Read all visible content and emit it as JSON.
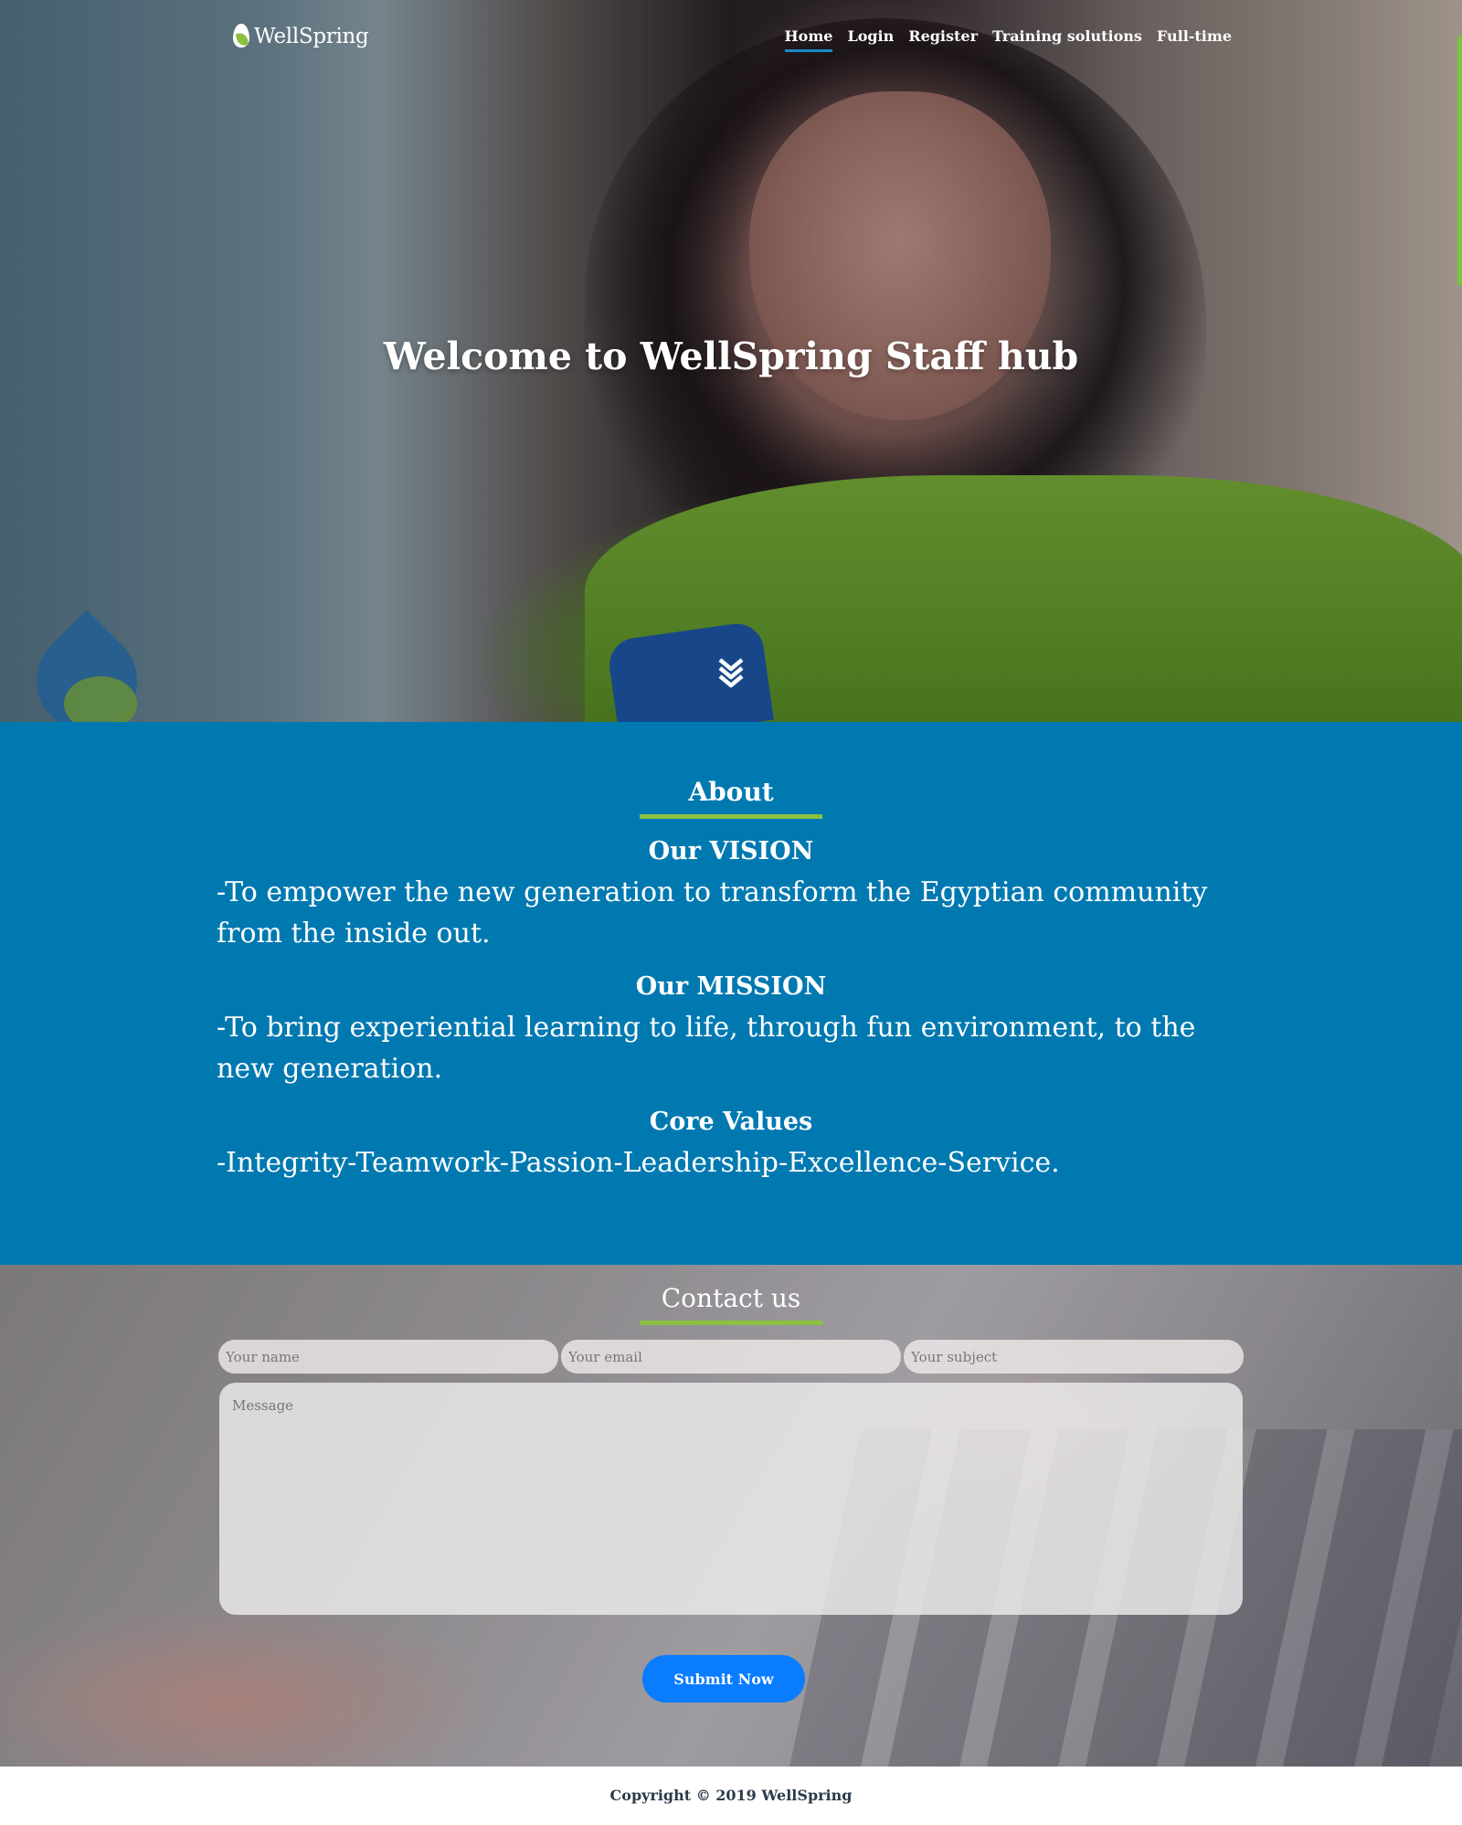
{
  "brand": {
    "name": "WellSpring",
    "logo_icon": "wellspring-drop-leaf-logo"
  },
  "nav": {
    "items": [
      {
        "label": "Home",
        "active": true
      },
      {
        "label": "Login",
        "active": false
      },
      {
        "label": "Register",
        "active": false
      },
      {
        "label": "Training solutions",
        "active": false
      },
      {
        "label": "Full-time",
        "active": false
      }
    ]
  },
  "hero": {
    "title": "Welcome to WellSpring Staff hub",
    "scroll_icon": "double-chevron-down-icon"
  },
  "about": {
    "heading": "About",
    "vision_title": "Our VISION",
    "vision_text": "-To empower the new generation to transform the Egyptian community from the inside out.",
    "mission_title": "Our MISSION",
    "mission_text": "-To bring experiential learning to life, through fun environment, to the new generation.",
    "values_title": "Core Values",
    "values_text": "-Integrity-Teamwork-Passion-Leadership-Excellence-Service."
  },
  "contact": {
    "heading": "Contact us",
    "name_placeholder": "Your name",
    "email_placeholder": "Your email",
    "subject_placeholder": "Your subject",
    "message_placeholder": "Message",
    "submit_label": "Submit Now"
  },
  "footer": {
    "copyright": "Copyright © 2019 WellSpring"
  },
  "colors": {
    "about_bg": "#0079b1",
    "accent_green": "#8bc13f",
    "nav_underline": "#1b88c9",
    "submit_bg": "#0a7cff"
  }
}
